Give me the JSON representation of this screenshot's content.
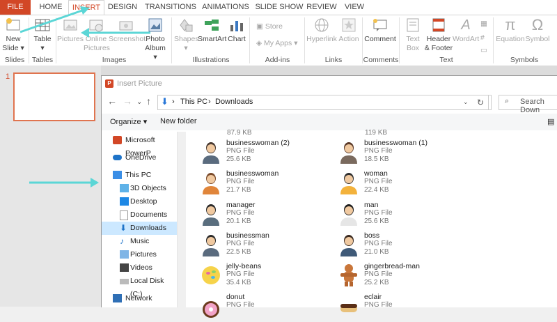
{
  "ribbon_tabs": [
    "FILE",
    "HOME",
    "INSERT",
    "DESIGN",
    "TRANSITIONS",
    "ANIMATIONS",
    "SLIDE SHOW",
    "REVIEW",
    "VIEW"
  ],
  "ribbon": {
    "new_slide": "New Slide",
    "table": "Table",
    "pictures": "Pictures",
    "online_pictures": "Online Pictures",
    "screenshot": "Screenshot",
    "photo_album": "Photo Album",
    "shapes": "Shapes",
    "smartart": "SmartArt",
    "chart": "Chart",
    "store": "Store",
    "my_addins": "My Apps",
    "hyperlink": "Hyperlink",
    "action": "Action",
    "comment": "Comment",
    "text_box": "Text Box",
    "header_footer": "Header & Footer",
    "wordart": "WordArt",
    "equation": "Equation",
    "symbol": "Symbol",
    "groups": [
      "Slides",
      "Tables",
      "Images",
      "Illustrations",
      "Add-ins",
      "Links",
      "Comments",
      "Text",
      "Symbols"
    ]
  },
  "slide_pane": {
    "number": "1"
  },
  "dialog": {
    "title": "Insert Picture",
    "path": [
      "This PC",
      "Downloads"
    ],
    "search_placeholder": "Search Down",
    "organize": "Organize",
    "new_folder": "New folder"
  },
  "tree": [
    {
      "label": "Microsoft PowerP"
    },
    {
      "label": "OneDrive"
    },
    {
      "label": "This PC"
    },
    {
      "label": "3D Objects"
    },
    {
      "label": "Desktop"
    },
    {
      "label": "Documents"
    },
    {
      "label": "Downloads"
    },
    {
      "label": "Music"
    },
    {
      "label": "Pictures"
    },
    {
      "label": "Videos"
    },
    {
      "label": "Local Disk (C:)"
    },
    {
      "label": "Network"
    }
  ],
  "top_sizes": [
    "87.9 KB",
    "119 KB"
  ],
  "files": [
    {
      "name": "businesswoman (2)",
      "type": "PNG File",
      "size": "25.6 KB"
    },
    {
      "name": "businesswoman (1)",
      "type": "PNG File",
      "size": "18.5 KB"
    },
    {
      "name": "businesswoman",
      "type": "PNG File",
      "size": "21.7 KB"
    },
    {
      "name": "woman",
      "type": "PNG File",
      "size": "22.4 KB"
    },
    {
      "name": "manager",
      "type": "PNG File",
      "size": "20.1 KB"
    },
    {
      "name": "man",
      "type": "PNG File",
      "size": "25.6 KB"
    },
    {
      "name": "businessman",
      "type": "PNG File",
      "size": "22.5 KB"
    },
    {
      "name": "boss",
      "type": "PNG File",
      "size": "21.0 KB"
    },
    {
      "name": "jelly-beans",
      "type": "PNG File",
      "size": "35.4 KB"
    },
    {
      "name": "gingerbread-man",
      "type": "PNG File",
      "size": "25.2 KB"
    },
    {
      "name": "donut",
      "type": "PNG File",
      "size": ""
    },
    {
      "name": "eclair",
      "type": "PNG File",
      "size": ""
    }
  ],
  "colors": {
    "accent": "#d24726",
    "selection": "#cce8ff",
    "arrow": "#5bd6d6"
  }
}
